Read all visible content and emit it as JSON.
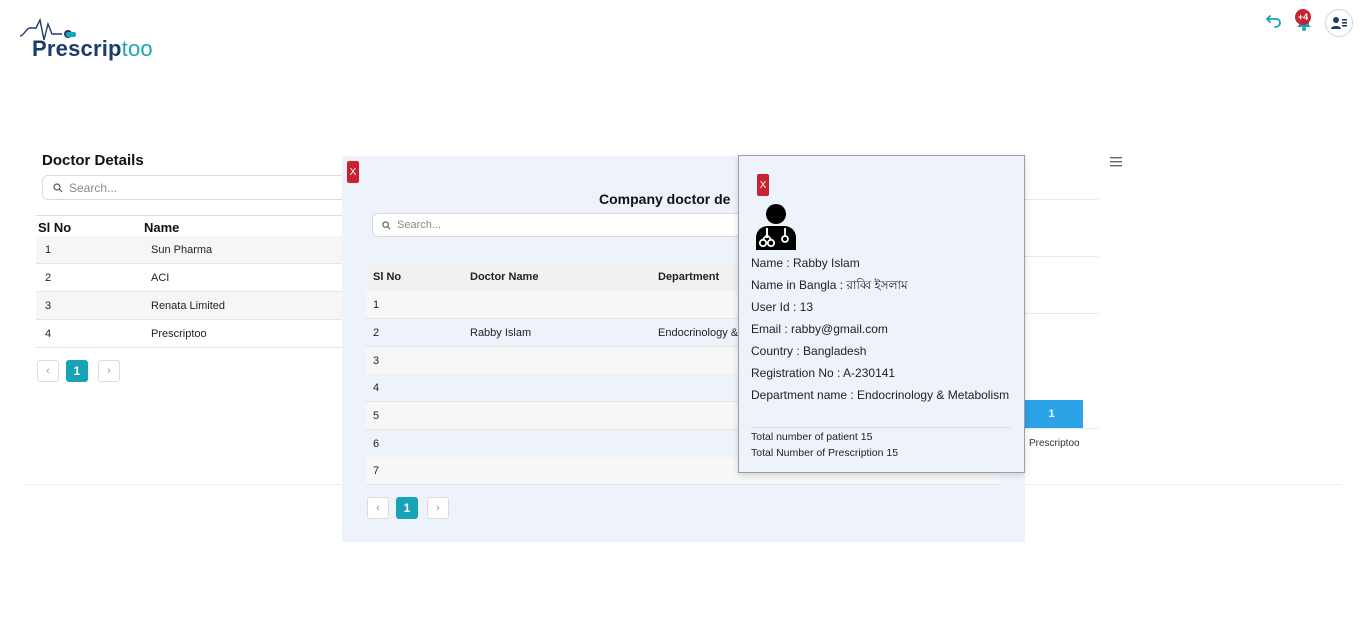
{
  "header": {
    "logo_main": "Prescrip",
    "logo_accent": "too",
    "notification_count": "+4"
  },
  "doctor_details": {
    "title": "Doctor Details",
    "search_placeholder": "Search...",
    "columns": [
      "Sl No",
      "Name"
    ],
    "rows": [
      {
        "sl": "1",
        "name": "Sun Pharma"
      },
      {
        "sl": "2",
        "name": "ACI"
      },
      {
        "sl": "3",
        "name": "Renata Limited"
      },
      {
        "sl": "4",
        "name": "Prescriptoo"
      }
    ],
    "pagination": {
      "prev": "‹",
      "page": "1",
      "next": "›"
    }
  },
  "background": {
    "bar_value": "1",
    "bar_label": "Prescriptoo"
  },
  "company_modal": {
    "close_label": "X",
    "title": "Company doctor de",
    "search_placeholder": "Search...",
    "columns": [
      "Sl No",
      "Doctor Name",
      "Department"
    ],
    "rows": [
      {
        "sl": "1",
        "doctor": "",
        "department": ""
      },
      {
        "sl": "2",
        "doctor": "Rabby Islam",
        "department": "Endocrinology &"
      },
      {
        "sl": "3",
        "doctor": "",
        "department": ""
      },
      {
        "sl": "4",
        "doctor": "",
        "department": ""
      },
      {
        "sl": "5",
        "doctor": "",
        "department": ""
      },
      {
        "sl": "6",
        "doctor": "",
        "department": ""
      },
      {
        "sl": "7",
        "doctor": "",
        "department": ""
      }
    ],
    "pagination": {
      "prev": "‹",
      "page": "1",
      "next": "›"
    }
  },
  "doctor_popup": {
    "close_label": "X",
    "name": "Name : Rabby Islam",
    "name_bangla": "Name in Bangla : রাব্বি ইসলাম",
    "user_id": "User Id : 13",
    "email": "Email : rabby@gmail.com",
    "country": "Country : Bangladesh",
    "registration": "Registration No : A-230141",
    "department": "Department name : Endocrinology & Metabolism",
    "total_patients": "Total number of patient 15",
    "total_prescriptions": "Total Number of Prescription 15"
  },
  "colors": {
    "brand_dark": "#1a3d6d",
    "brand_teal": "#17a2b8",
    "close_red": "#c82333",
    "bar_blue": "#2ba3e8"
  }
}
